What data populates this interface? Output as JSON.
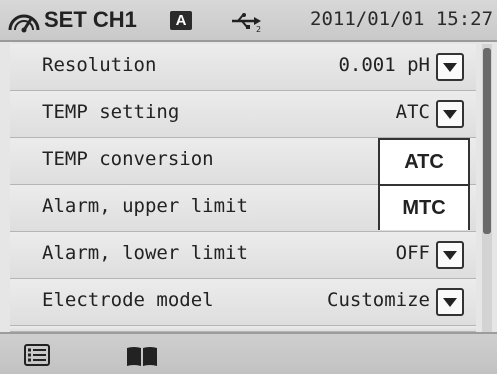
{
  "status_bar": {
    "title": "SET CH1",
    "mode_badge": "A",
    "datetime": "2011/01/01 15:27",
    "icons": [
      "gauge-icon",
      "usb-icon"
    ]
  },
  "settings": [
    {
      "label": "Resolution",
      "value": "0.001 pH"
    },
    {
      "label": "TEMP setting",
      "value": "ATC"
    },
    {
      "label": "TEMP conversion",
      "value": ""
    },
    {
      "label": "Alarm, upper limit",
      "value": ""
    },
    {
      "label": "Alarm, lower limit",
      "value": "OFF"
    },
    {
      "label": "Electrode model",
      "value": "Customize"
    }
  ],
  "popup": {
    "options": [
      "ATC",
      "MTC"
    ]
  },
  "toolbar": {
    "icons": [
      "menu-list-icon",
      "book-icon"
    ]
  },
  "colors": {
    "background": "#e6e6e6",
    "scroll_thumb": "#6a6a6a",
    "badge": "#2b2b2b"
  }
}
